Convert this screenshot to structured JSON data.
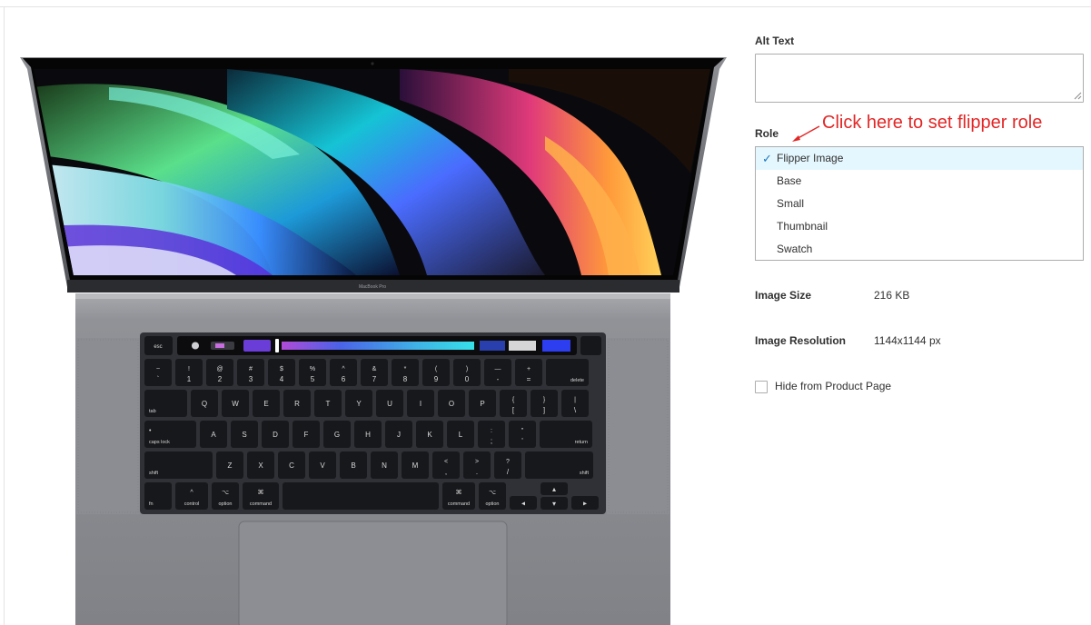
{
  "image_panel": {
    "screen_brand_text": "MacBook Pro",
    "keyboard": {
      "row0": [
        "esc"
      ],
      "row1": [
        {
          "top": "~",
          "bottom": "`"
        },
        {
          "top": "!",
          "bottom": "1"
        },
        {
          "top": "@",
          "bottom": "2"
        },
        {
          "top": "#",
          "bottom": "3"
        },
        {
          "top": "$",
          "bottom": "4"
        },
        {
          "top": "%",
          "bottom": "5"
        },
        {
          "top": "^",
          "bottom": "6"
        },
        {
          "top": "&",
          "bottom": "7"
        },
        {
          "top": "*",
          "bottom": "8"
        },
        {
          "top": "(",
          "bottom": "9"
        },
        {
          "top": ")",
          "bottom": "0"
        },
        {
          "top": "—",
          "bottom": "-"
        },
        {
          "top": "+",
          "bottom": "="
        },
        {
          "top": "",
          "bottom": "delete"
        }
      ],
      "row2": [
        "tab",
        "Q",
        "W",
        "E",
        "R",
        "T",
        "Y",
        "U",
        "I",
        "O",
        "P",
        "{ [",
        "} ]",
        "| \\"
      ],
      "row3": [
        "caps lock",
        "A",
        "S",
        "D",
        "F",
        "G",
        "H",
        "J",
        "K",
        "L",
        ": ;",
        "\" '",
        "return"
      ],
      "row4": [
        "shift",
        "Z",
        "X",
        "C",
        "V",
        "B",
        "N",
        "M",
        "< ,",
        "> .",
        "? /",
        "shift"
      ],
      "row5": [
        {
          "top": "",
          "bottom": "fn"
        },
        {
          "top": "^",
          "bottom": "control"
        },
        {
          "top": "⌥",
          "bottom": "option"
        },
        {
          "top": "⌘",
          "bottom": "command"
        },
        {
          "top": "",
          "bottom": ""
        },
        {
          "top": "⌘",
          "bottom": "command"
        },
        {
          "top": "⌥",
          "bottom": "option"
        }
      ]
    }
  },
  "alt_text": {
    "label": "Alt Text",
    "value": ""
  },
  "role": {
    "label": "Role",
    "annotation": "Click here to set flipper role",
    "options": [
      {
        "label": "Flipper Image",
        "selected": true
      },
      {
        "label": "Base",
        "selected": false
      },
      {
        "label": "Small",
        "selected": false
      },
      {
        "label": "Thumbnail",
        "selected": false
      },
      {
        "label": "Swatch",
        "selected": false
      }
    ]
  },
  "image_info": {
    "size_label": "Image Size",
    "size_value": "216 KB",
    "resolution_label": "Image Resolution",
    "resolution_value": "1144x1144 px"
  },
  "hide_from_product_page": {
    "label": "Hide from Product Page",
    "checked": false
  },
  "colors": {
    "selected_option_bg": "#e5f7fe",
    "check_color": "#1979c3",
    "annotation_color": "#e22626",
    "border": "#adadad"
  },
  "icons": {
    "selected_check": "check-icon",
    "annotation_arrow": "arrow-icon"
  }
}
